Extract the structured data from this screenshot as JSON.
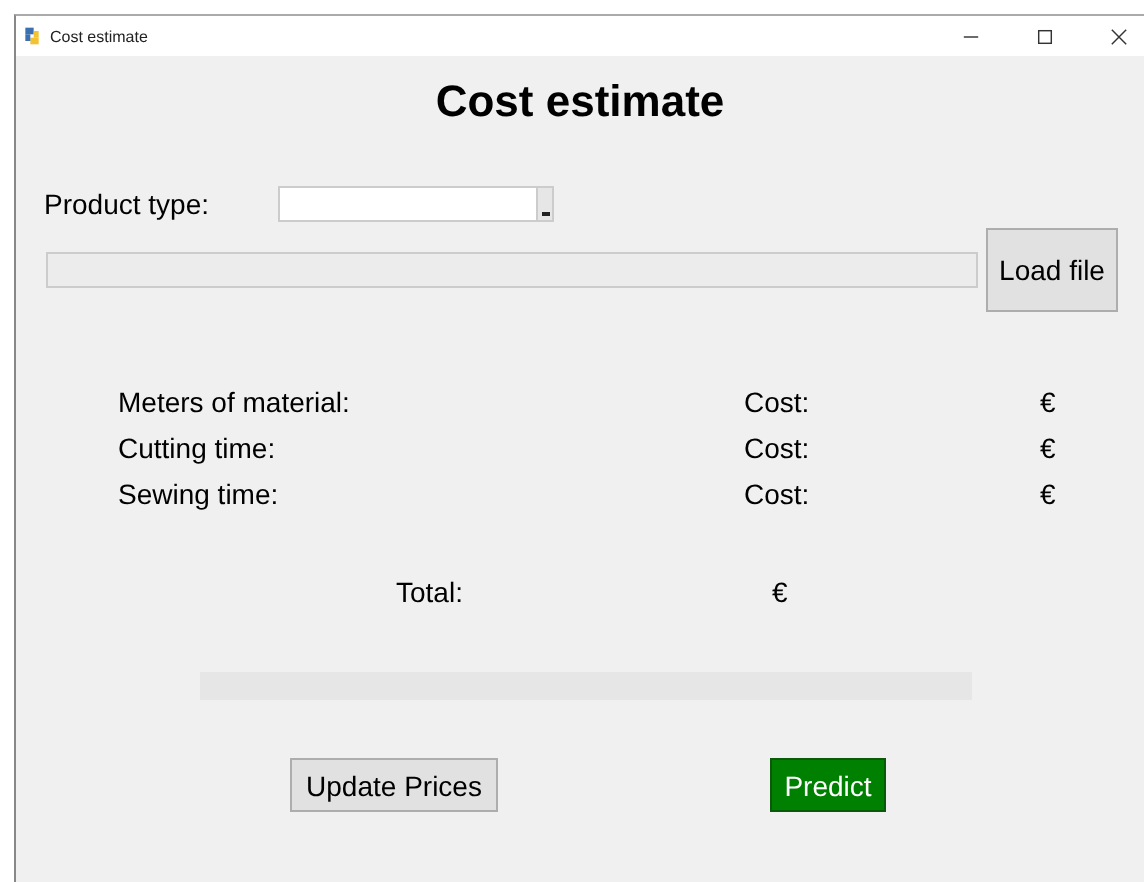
{
  "window": {
    "title": "Cost estimate"
  },
  "heading": "Cost estimate",
  "product_type": {
    "label": "Product type:"
  },
  "load_button": "Load file",
  "rows": [
    {
      "label": "Meters of material:",
      "cost_label": "Cost:",
      "currency": "€"
    },
    {
      "label": "Cutting time:",
      "cost_label": "Cost:",
      "currency": "€"
    },
    {
      "label": "Sewing time:",
      "cost_label": "Cost:",
      "currency": "€"
    }
  ],
  "total": {
    "label": "Total:",
    "currency": "€"
  },
  "buttons": {
    "update": "Update Prices",
    "predict": "Predict"
  }
}
